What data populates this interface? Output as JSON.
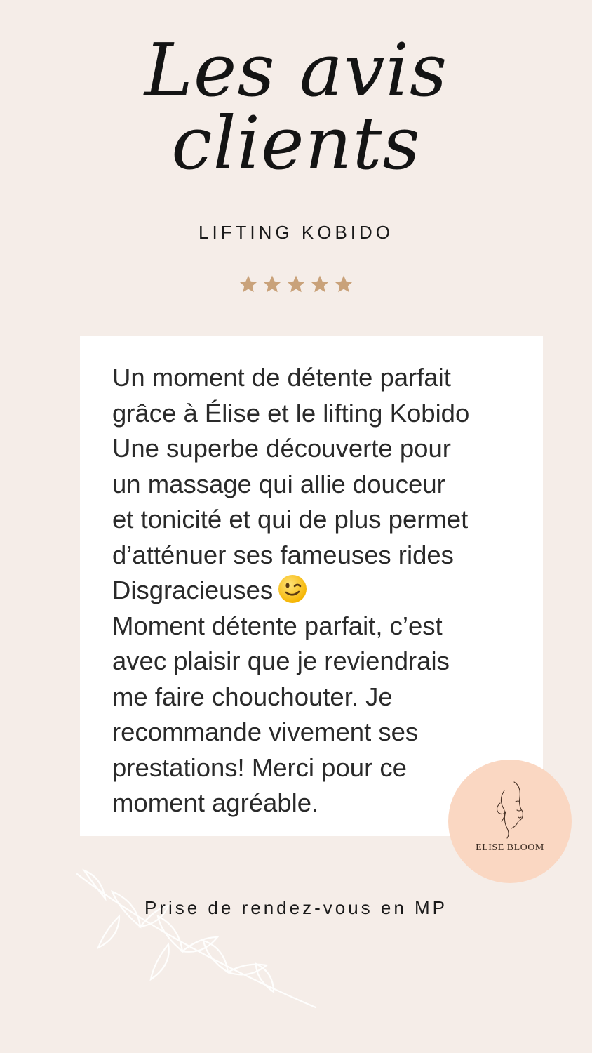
{
  "header": {
    "title_line1": "Les avis",
    "title_line2": "clients",
    "subtitle": "LIFTING KOBIDO"
  },
  "rating": {
    "stars": 5,
    "max": 5,
    "star_color": "#c9a27a"
  },
  "review": {
    "lines": [
      "Un moment de détente parfait",
      "grâce à Élise et le lifting Kobido",
      "Une superbe découverte pour",
      "un massage qui allie douceur",
      "et tonicité et qui de plus permet",
      "d’atténuer ses fameuses rides",
      "Disgracieuses",
      "Moment détente parfait, c’est",
      "avec plaisir que je reviendrais",
      "me faire chouchouter. Je",
      "recommande vivement ses",
      "prestations! Merci pour ce",
      "moment agréable."
    ],
    "emoji": "winking-face"
  },
  "logo": {
    "name": "ELISE BLOOM",
    "background": "#fad7c2"
  },
  "footer": {
    "text": "Prise de rendez-vous en MP"
  },
  "colors": {
    "background": "#f5ede8",
    "card": "#ffffff",
    "text": "#2a2a2a"
  }
}
